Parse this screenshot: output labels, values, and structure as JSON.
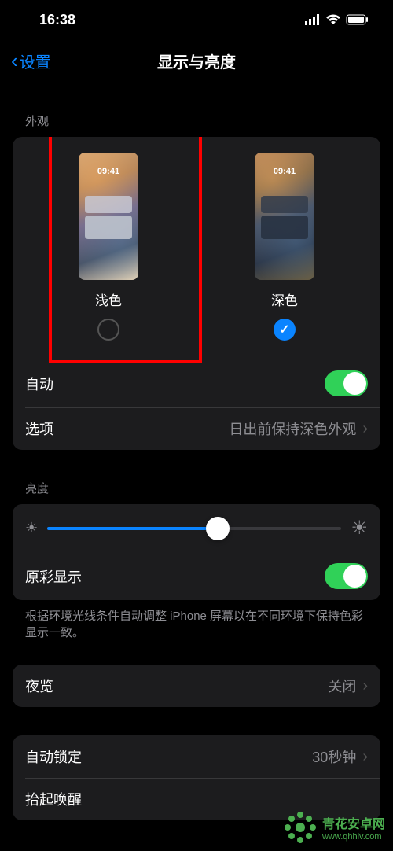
{
  "status": {
    "time": "16:38"
  },
  "nav": {
    "back_label": "设置",
    "title": "显示与亮度"
  },
  "appearance": {
    "header": "外观",
    "preview_time": "09:41",
    "light_label": "浅色",
    "dark_label": "深色",
    "selected": "dark",
    "auto_label": "自动",
    "auto_on": true,
    "options_label": "选项",
    "options_value": "日出前保持深色外观"
  },
  "brightness": {
    "header": "亮度",
    "slider_percent": 58,
    "true_tone_label": "原彩显示",
    "true_tone_on": true,
    "footer": "根据环境光线条件自动调整 iPhone 屏幕以在不同环境下保持色彩显示一致。"
  },
  "night_shift": {
    "label": "夜览",
    "value": "关闭"
  },
  "auto_lock": {
    "label": "自动锁定",
    "value": "30秒钟"
  },
  "raise_to_wake": {
    "label": "抬起唤醒"
  },
  "watermark": {
    "title": "青花安卓网",
    "url": "www.qhhlv.com"
  }
}
